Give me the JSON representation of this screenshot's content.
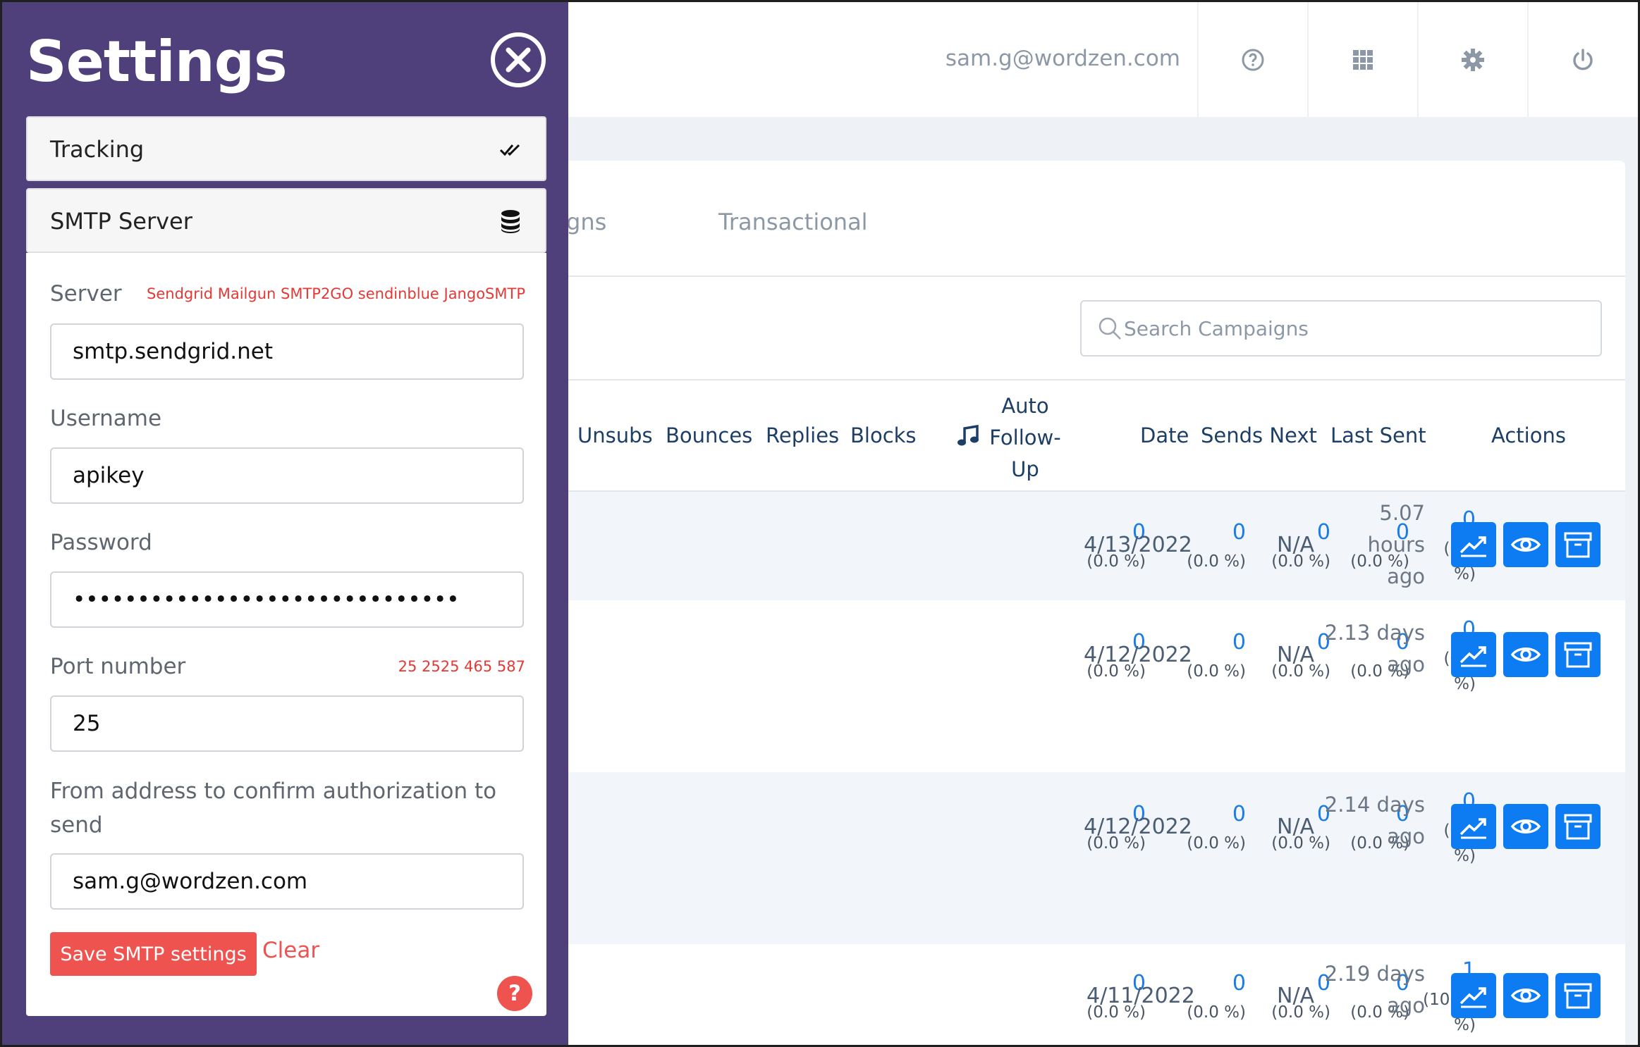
{
  "header": {
    "user_email": "sam.g@wordzen.com",
    "icons": [
      "help-circle-icon",
      "apps-grid-icon",
      "gear-icon",
      "power-icon"
    ]
  },
  "tabs": {
    "partial_label": "gns",
    "transactional": "Transactional"
  },
  "search": {
    "placeholder": "Search Campaigns"
  },
  "table": {
    "columns": {
      "unsubs": "Unsubs",
      "bounces": "Bounces",
      "replies": "Replies",
      "blocks": "Blocks",
      "auto_followup_line1": "Auto",
      "auto_followup_line2": "Follow-",
      "auto_followup_line3": "Up",
      "date": "Date",
      "sends_next": "Sends Next",
      "last_sent": "Last Sent",
      "actions": "Actions"
    },
    "rows": [
      {
        "unsubs": "0",
        "unsubs_pct": "(0.0 %)",
        "bounces": "0",
        "bounces_pct": "(0.0 %)",
        "replies": "0",
        "replies_pct": "(0.0 %)",
        "blocks": "0",
        "blocks_pct": "(0.0 %)",
        "followup": "0",
        "followup_pct1": "(0.0",
        "followup_pct2": "%)",
        "date": "4/13/2022",
        "sends_next": "N/A",
        "last_sent_l1": "5.07",
        "last_sent_l2": "hours",
        "last_sent_l3": "ago"
      },
      {
        "unsubs": "0",
        "unsubs_pct": "(0.0 %)",
        "bounces": "0",
        "bounces_pct": "(0.0 %)",
        "replies": "0",
        "replies_pct": "(0.0 %)",
        "blocks": "0",
        "blocks_pct": "(0.0 %)",
        "followup": "0",
        "followup_pct1": "(0.0",
        "followup_pct2": "%)",
        "date": "4/12/2022",
        "sends_next": "N/A",
        "last_sent_l1": "2.13 days",
        "last_sent_l2": "ago",
        "last_sent_l3": ""
      },
      {
        "unsubs": "0",
        "unsubs_pct": "(0.0 %)",
        "bounces": "0",
        "bounces_pct": "(0.0 %)",
        "replies": "0",
        "replies_pct": "(0.0 %)",
        "blocks": "0",
        "blocks_pct": "(0.0 %)",
        "followup": "0",
        "followup_pct1": "(0.0",
        "followup_pct2": "%)",
        "date": "4/12/2022",
        "sends_next": "N/A",
        "last_sent_l1": "2.14 days",
        "last_sent_l2": "ago",
        "last_sent_l3": ""
      },
      {
        "unsubs": "0",
        "unsubs_pct": "(0.0 %)",
        "bounces": "0",
        "bounces_pct": "(0.0 %)",
        "replies": "0",
        "replies_pct": "(0.0 %)",
        "blocks": "0",
        "blocks_pct": "(0.0 %)",
        "followup": "1",
        "followup_pct1": "(100.0",
        "followup_pct2": "%)",
        "date": "4/11/2022",
        "sends_next": "N/A",
        "last_sent_l1": "2.19 days",
        "last_sent_l2": "ago",
        "last_sent_l3": ""
      }
    ]
  },
  "settings": {
    "title": "Settings",
    "sections": {
      "tracking": "Tracking",
      "smtp": "SMTP Server"
    },
    "form": {
      "server_label": "Server",
      "server_presets": "Sendgrid Mailgun SMTP2GO sendinblue JangoSMTP",
      "server_value": "smtp.sendgrid.net",
      "username_label": "Username",
      "username_value": "apikey",
      "password_label": "Password",
      "password_value": "••••••••••••••••••••••••••••••",
      "port_label": "Port number",
      "port_presets": "25 2525 465 587",
      "port_value": "25",
      "from_label": "From address to confirm authorization to send",
      "from_value": "sam.g@wordzen.com",
      "save_button": "Save SMTP settings",
      "clear_link": "Clear",
      "help_button": "?"
    }
  },
  "colors": {
    "panel_bg": "#4f3f7b",
    "accent_blue": "#0d7cf2",
    "danger_red": "#ef5350",
    "heading_navy": "#1d3f66"
  }
}
